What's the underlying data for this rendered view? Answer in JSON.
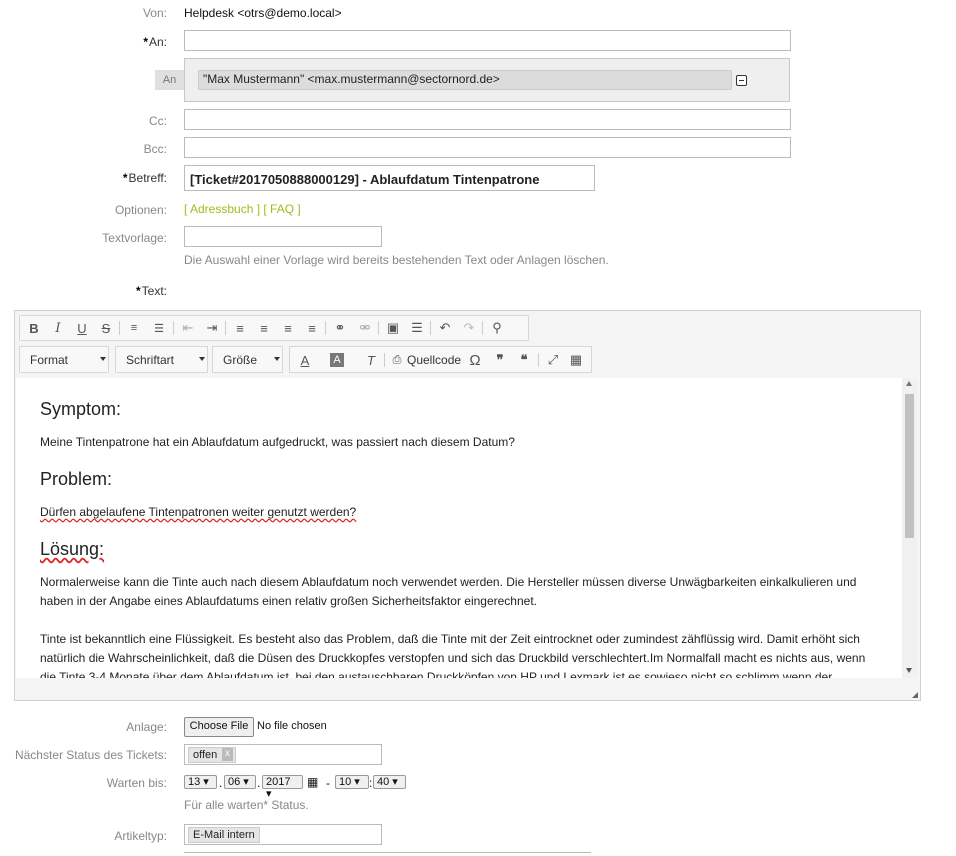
{
  "from": {
    "label": "Von:",
    "value": "Helpdesk <otrs@demo.local>"
  },
  "to": {
    "label": "An:",
    "value": ""
  },
  "recipient": {
    "tag": "An",
    "value": "\"Max Mustermann\" <max.mustermann@sectornord.de>"
  },
  "cc": {
    "label": "Cc:"
  },
  "bcc": {
    "label": "Bcc:"
  },
  "subject": {
    "label": "Betreff:",
    "value": "[Ticket#2017050888000129]  - Ablaufdatum Tintenpatrone"
  },
  "options": {
    "label": "Optionen:",
    "addressbook": "[ Adressbuch ]",
    "faq": "[ FAQ ]"
  },
  "template": {
    "label": "Textvorlage:",
    "hint": "Die Auswahl einer Vorlage wird bereits bestehenden Text oder Anlagen löschen."
  },
  "text": {
    "label": "Text:"
  },
  "editor": {
    "format": "Format",
    "font": "Schriftart",
    "size": "Größe",
    "source": "Quellcode",
    "h_symptom": "Symptom:",
    "p_symptom": "Meine Tintenpatrone hat ein Ablaufdatum aufgedruckt, was passiert nach diesem Datum?",
    "h_problem": "Problem:",
    "p_problem": "Dürfen abgelaufene Tintenpatronen weiter genutzt werden?",
    "h_solution": "Lösung:",
    "p_solution1": "Normalerweise kann die Tinte auch nach diesem Ablaufdatum noch verwendet werden. Die Hersteller müssen diverse Unwägbarkeiten einkalkulieren und haben in der Angabe eines Ablaufdatums einen relativ großen Sicherheitsfaktor eingerechnet.",
    "p_solution2": "Tinte ist bekanntlich eine Flüssigkeit. Es besteht also das Problem, daß die Tinte mit der Zeit eintrocknet oder zumindest zähflüssig wird. Damit erhöht sich natürlich die Wahrscheinlichkeit, daß die Düsen des Druckkopfes verstopfen und sich das Druckbild verschlechtert.Im Normalfall macht es nichts aus, wenn die Tinte 3-4 Monate über dem Ablaufdatum ist, bei den austauschbaren Druckköpfen von HP und Lexmark ist es sowieso nicht so schlimm wenn der"
  },
  "attachment": {
    "label": "Anlage:",
    "button": "Choose File",
    "status": "No file chosen"
  },
  "next_state": {
    "label": "Nächster Status des Tickets:",
    "value": "offen",
    "remove": "x"
  },
  "pending": {
    "label": "Warten bis:",
    "day": "13",
    "month": "06",
    "year": "2017",
    "hour": "10",
    "minute": "40",
    "hint": "Für alle warten* Status."
  },
  "article_type": {
    "label": "Artikeltyp:",
    "value": "E-Mail intern"
  }
}
